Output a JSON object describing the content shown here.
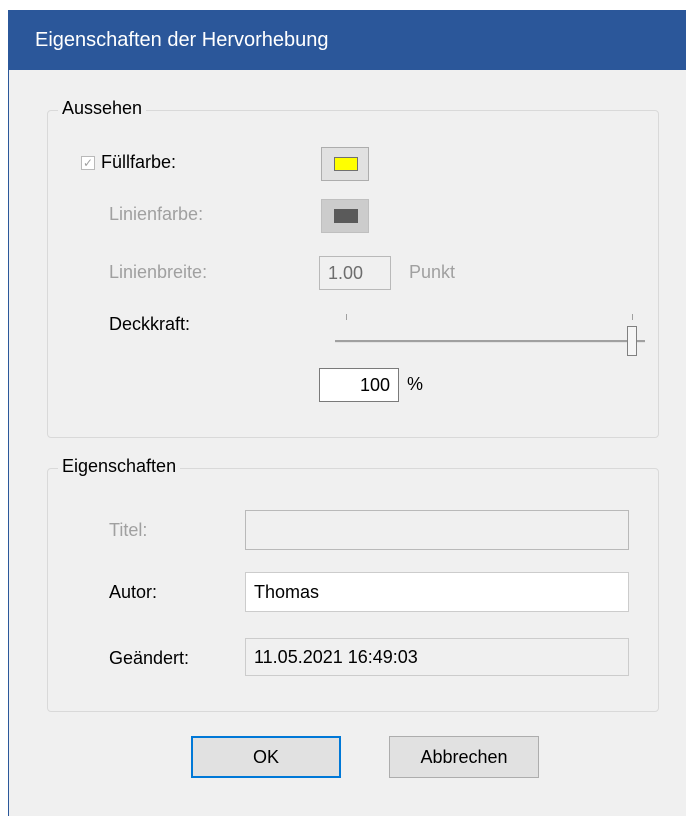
{
  "dialog": {
    "title": "Eigenschaften der Hervorhebung"
  },
  "appearance": {
    "group_title": "Aussehen",
    "fill_color": {
      "label": "Füllfarbe:",
      "checked": true,
      "color": "#ffff00"
    },
    "line_color": {
      "label": "Linienfarbe:",
      "color": "#5a5a5a"
    },
    "line_width": {
      "label": "Linienbreite:",
      "value": "1.00",
      "unit": "Punkt"
    },
    "opacity": {
      "label": "Deckkraft:",
      "value": "100",
      "unit": "%",
      "slider_fraction": 1.0
    }
  },
  "properties": {
    "group_title": "Eigenschaften",
    "title": {
      "label": "Titel:",
      "value": ""
    },
    "author": {
      "label": "Autor:",
      "value": "Thomas"
    },
    "modified": {
      "label": "Geändert:",
      "value": "11.05.2021 16:49:03"
    }
  },
  "buttons": {
    "ok_label": "OK",
    "cancel_label": "Abbrechen"
  },
  "colors": {
    "titlebar": "#2b579a",
    "accent": "#0078d7"
  }
}
